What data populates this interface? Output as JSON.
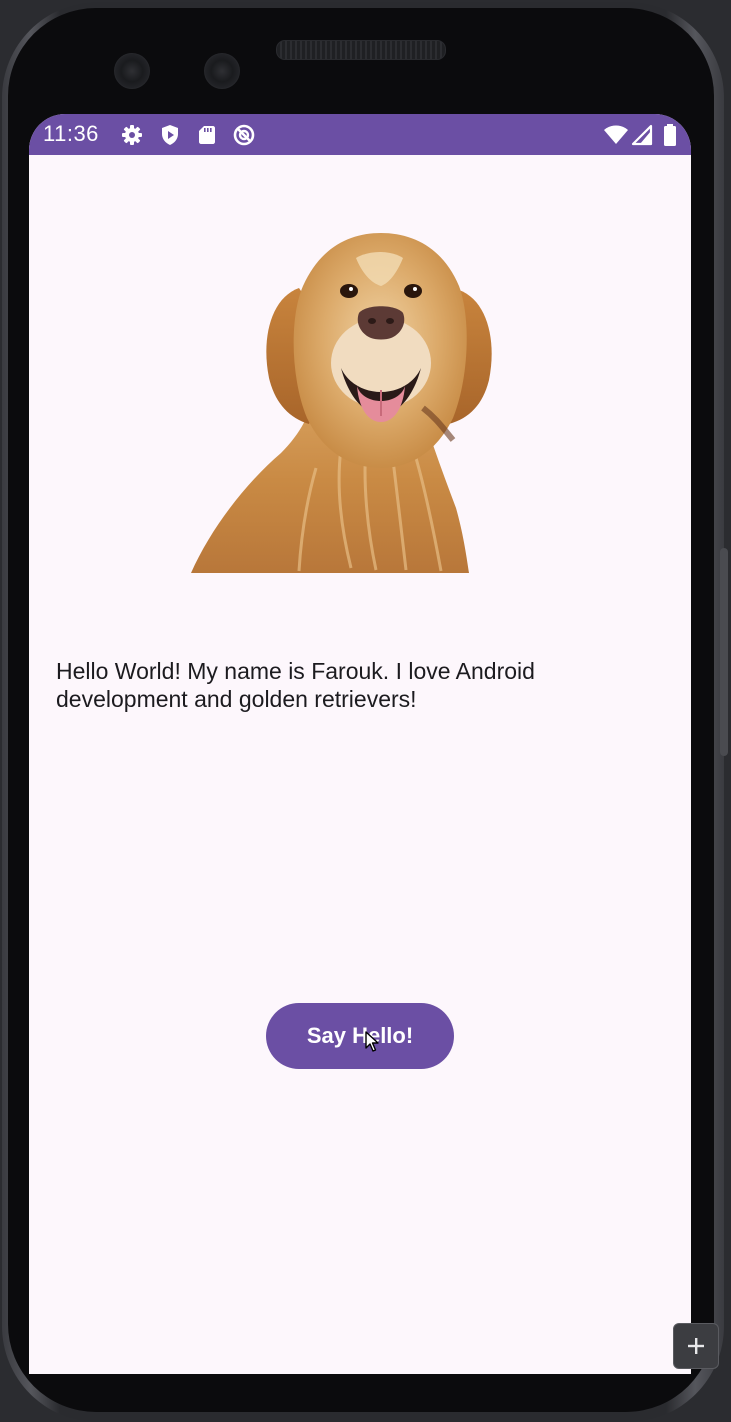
{
  "status_bar": {
    "time": "11:36",
    "icons": [
      "settings-gear-icon",
      "play-protect-shield-icon",
      "sd-card-icon",
      "no-location-icon",
      "wifi-icon",
      "cellular-signal-icon",
      "battery-icon"
    ],
    "background": "#6b4fa4"
  },
  "main": {
    "image": "golden-retriever-photo",
    "bio_text": "Hello World! My name is Farouk. I love Android development and golden retrievers!",
    "button_label": "Say Hello!",
    "background": "#fdf7fc",
    "accent": "#6b4fa4"
  },
  "emulator": {
    "zoom_label": "+"
  }
}
